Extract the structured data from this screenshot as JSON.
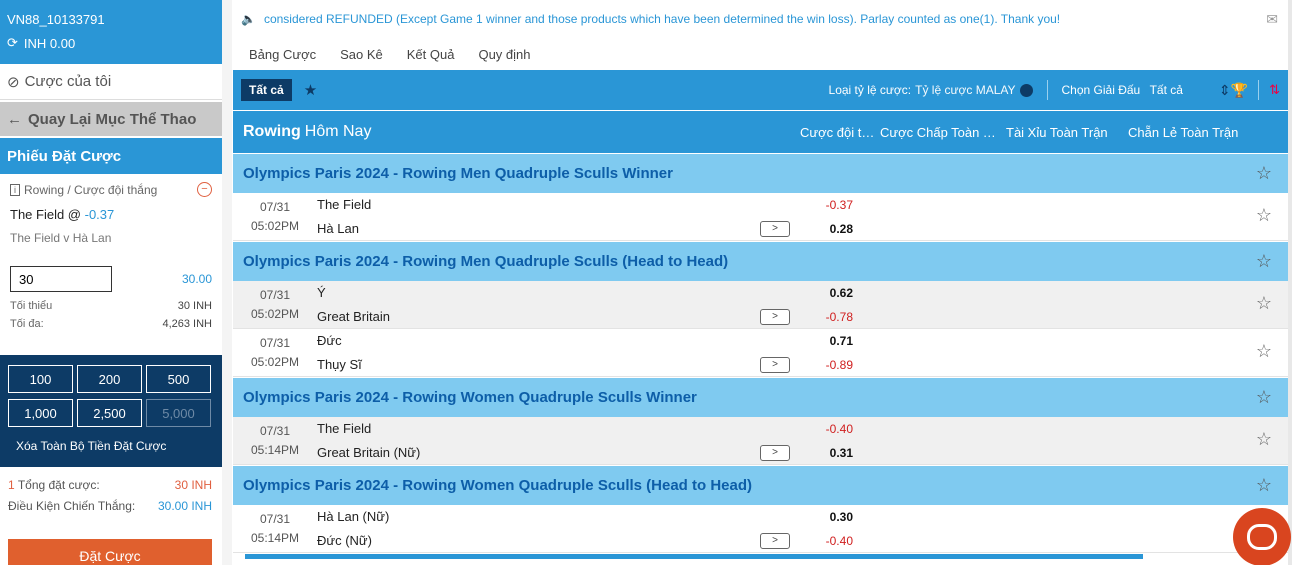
{
  "account": {
    "user_id": "VN88_10133791",
    "balance": "INH 0.00"
  },
  "sidebar": {
    "my_bets": "Cược của tôi",
    "back": "Quay Lại Mục Thể Thao",
    "slip_title": "Phiếu Đặt Cược"
  },
  "slip": {
    "market": "Rowing / Cược đội thắng",
    "pick": "The Field @",
    "pick_odds": "-0.37",
    "match": "The Field v Hà Lan",
    "stake_value": "30",
    "stake_amount": "30.00",
    "min_label": "Tối thiểu",
    "min_value": "30 INH",
    "max_label": "Tối đa:",
    "max_value": "4,263 INH",
    "chips": [
      "100",
      "200",
      "500",
      "1,000",
      "2,500",
      "5,000"
    ],
    "clear_label": "Xóa Toàn Bộ Tiền Đặt Cược",
    "total_count": "1",
    "total_label": "Tổng đặt cược:",
    "total_value": "30 INH",
    "win_label": "Điều Kiện Chiến Thắng:",
    "win_value": "30.00 INH",
    "place_label": "Đặt Cược"
  },
  "notice": "considered REFUNDED (Except Game 1 winner and those products which have been determined the win loss). Parlay counted as one(1). Thank you!",
  "nav_tabs": [
    "Bảng Cược",
    "Sao Kê",
    "Kết Quả",
    "Quy định"
  ],
  "toolbar": {
    "all": "Tất cả",
    "odds_type_label": "Loại tỷ lệ cược:",
    "odds_type_value": "Tỷ lệ cược MALAY",
    "league_label": "Chọn Giải Đấu",
    "league_value": "Tất cả"
  },
  "sport_header": {
    "sport": "Rowing",
    "period": "Hôm Nay",
    "columns": [
      "Cược đội thắng",
      "Cược Chấp Toàn Trận",
      "Tài Xỉu Toàn Trận",
      "Chẵn Lẻ Toàn Trận"
    ]
  },
  "leagues": [
    {
      "name": "Olympics Paris 2024 - Rowing Men Quadruple Sculls Winner",
      "events": [
        {
          "date": "07/31",
          "time": "05:02PM",
          "team1": "The Field",
          "team2": "Hà Lan",
          "odd1": "-0.37",
          "odd2": "0.28"
        }
      ]
    },
    {
      "name": "Olympics Paris 2024 - Rowing Men Quadruple Sculls (Head to Head)",
      "events": [
        {
          "date": "07/31",
          "time": "05:02PM",
          "team1": "Ý",
          "team2": "Great Britain",
          "odd1": "0.62",
          "odd2": "-0.78"
        },
        {
          "date": "07/31",
          "time": "05:02PM",
          "team1": "Đức",
          "team2": "Thụy Sĩ",
          "odd1": "0.71",
          "odd2": "-0.89"
        }
      ]
    },
    {
      "name": "Olympics Paris 2024 - Rowing Women Quadruple Sculls Winner",
      "events": [
        {
          "date": "07/31",
          "time": "05:14PM",
          "team1": "The Field",
          "team2": "Great Britain (Nữ)",
          "odd1": "-0.40",
          "odd2": "0.31"
        }
      ]
    },
    {
      "name": "Olympics Paris 2024 - Rowing Women Quadruple Sculls (Head to Head)",
      "events": [
        {
          "date": "07/31",
          "time": "05:14PM",
          "team1": "Hà Lan (Nữ)",
          "team2": "Đức (Nữ)",
          "odd1": "0.30",
          "odd2": "-0.40"
        }
      ]
    }
  ]
}
